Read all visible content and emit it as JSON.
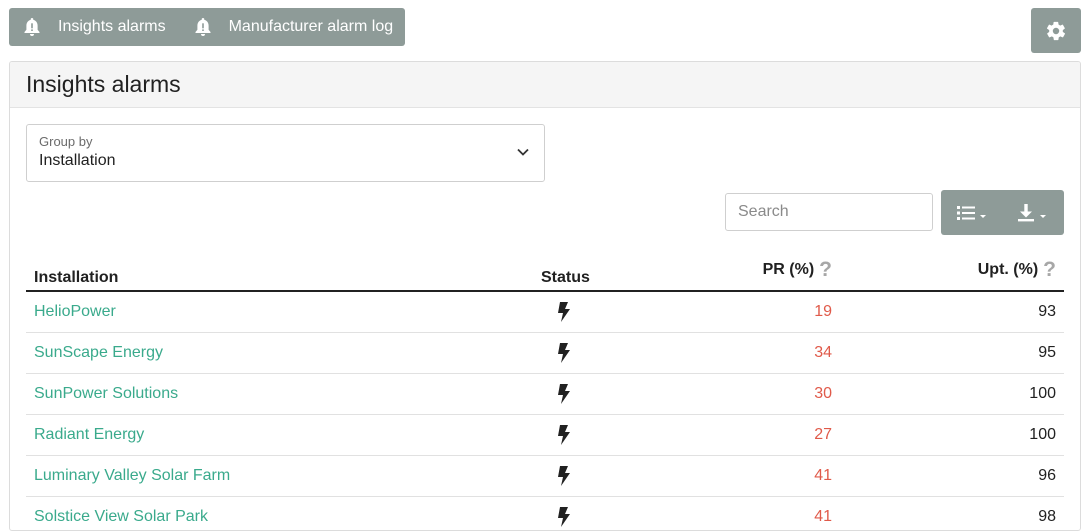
{
  "tabs": [
    {
      "label": "Insights alarms",
      "icon": "bell-alert-icon"
    },
    {
      "label": "Manufacturer alarm log",
      "icon": "bell-alert-icon"
    }
  ],
  "settings": {
    "icon": "gear-icon"
  },
  "card": {
    "title": "Insights alarms"
  },
  "group_by": {
    "label": "Group by",
    "value": "Installation"
  },
  "search": {
    "placeholder": "Search"
  },
  "toolbar": {
    "columns_icon": "list-icon",
    "download_icon": "download-icon"
  },
  "table": {
    "headers": {
      "installation": "Installation",
      "status": "Status",
      "pr": "PR (%)",
      "upt": "Upt. (%)"
    },
    "rows": [
      {
        "name": "HelioPower",
        "status": "power-icon",
        "pr": "19",
        "upt": "93"
      },
      {
        "name": "SunScape Energy",
        "status": "power-icon",
        "pr": "34",
        "upt": "95"
      },
      {
        "name": "SunPower Solutions",
        "status": "power-icon",
        "pr": "30",
        "upt": "100"
      },
      {
        "name": "Radiant Energy",
        "status": "power-icon",
        "pr": "27",
        "upt": "100"
      },
      {
        "name": "Luminary Valley Solar Farm",
        "status": "power-icon",
        "pr": "41",
        "upt": "96"
      },
      {
        "name": "Solstice View Solar Park",
        "status": "power-icon",
        "pr": "41",
        "upt": "98"
      }
    ]
  },
  "colors": {
    "toolbar_bg": "#8e9b98",
    "link": "#3aaa8c",
    "pr_value": "#e05a4a"
  }
}
